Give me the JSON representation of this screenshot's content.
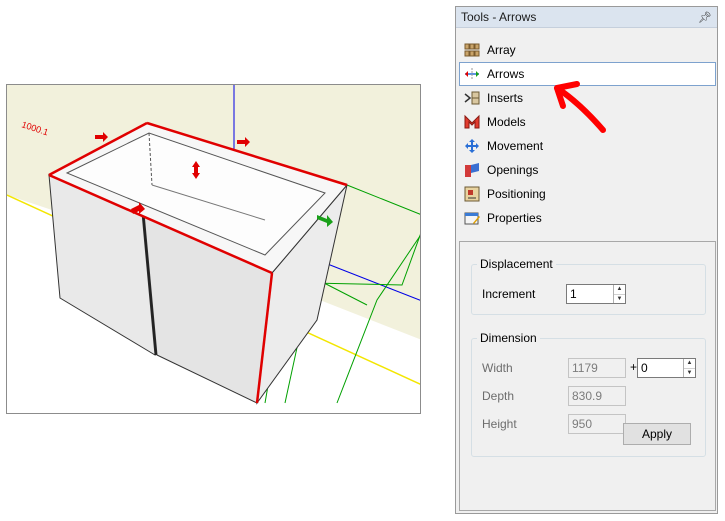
{
  "panel": {
    "title": "Tools - Arrows",
    "pin_glyph": "⭿"
  },
  "tools": [
    {
      "label": "Array",
      "icon": "array-icon",
      "selected": false
    },
    {
      "label": "Arrows",
      "icon": "arrows-icon",
      "selected": true
    },
    {
      "label": "Inserts",
      "icon": "inserts-icon",
      "selected": false
    },
    {
      "label": "Models",
      "icon": "models-icon",
      "selected": false
    },
    {
      "label": "Movement",
      "icon": "movement-icon",
      "selected": false
    },
    {
      "label": "Openings",
      "icon": "openings-icon",
      "selected": false
    },
    {
      "label": "Positioning",
      "icon": "positioning-icon",
      "selected": false
    },
    {
      "label": "Properties",
      "icon": "properties-icon",
      "selected": false
    }
  ],
  "displacement": {
    "legend": "Displacement",
    "increment_label": "Increment",
    "increment_value": "1"
  },
  "dimension": {
    "legend": "Dimension",
    "width_label": "Width",
    "width_value": "1179",
    "plus": "+",
    "width_offset": "0",
    "depth_label": "Depth",
    "depth_value": "830.9",
    "height_label": "Height",
    "height_value": "950",
    "apply_label": "Apply"
  },
  "viewport": {
    "dimension_label": "1000.1",
    "colors": {
      "floor": "#f2f1dc",
      "cabinet_side": "#e6e6e6",
      "cabinet_door": "#e9e9e9",
      "edge_highlight": "#e00000",
      "axis_blue": "#0000e6",
      "guide_green": "#00a000",
      "floor_line": "#f3e600"
    }
  },
  "annotation": {
    "color": "#ff0000"
  }
}
